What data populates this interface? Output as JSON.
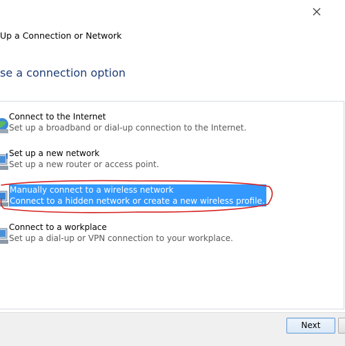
{
  "window": {
    "title": "Up a Connection or Network"
  },
  "page": {
    "heading": "se a connection option"
  },
  "options": [
    {
      "title": "Connect to the Internet",
      "description": "Set up a broadband or dial-up connection to the Internet.",
      "icon": "globe-network-icon",
      "selected": false
    },
    {
      "title": "Set up a new network",
      "description": "Set up a new router or access point.",
      "icon": "router-network-icon",
      "selected": false
    },
    {
      "title": "Manually connect to a wireless network",
      "description": "Connect to a hidden network or create a new wireless profile.",
      "icon": "wireless-network-icon",
      "selected": true
    },
    {
      "title": "Connect to a workplace",
      "description": "Set up a dial-up or VPN connection to your workplace.",
      "icon": "workplace-network-icon",
      "selected": false
    }
  ],
  "footer": {
    "next_label": "Next"
  },
  "colors": {
    "heading": "#1e3c78",
    "selection": "#3399ff",
    "annotation": "#d42020",
    "footer_bg": "#f0f0f0"
  }
}
